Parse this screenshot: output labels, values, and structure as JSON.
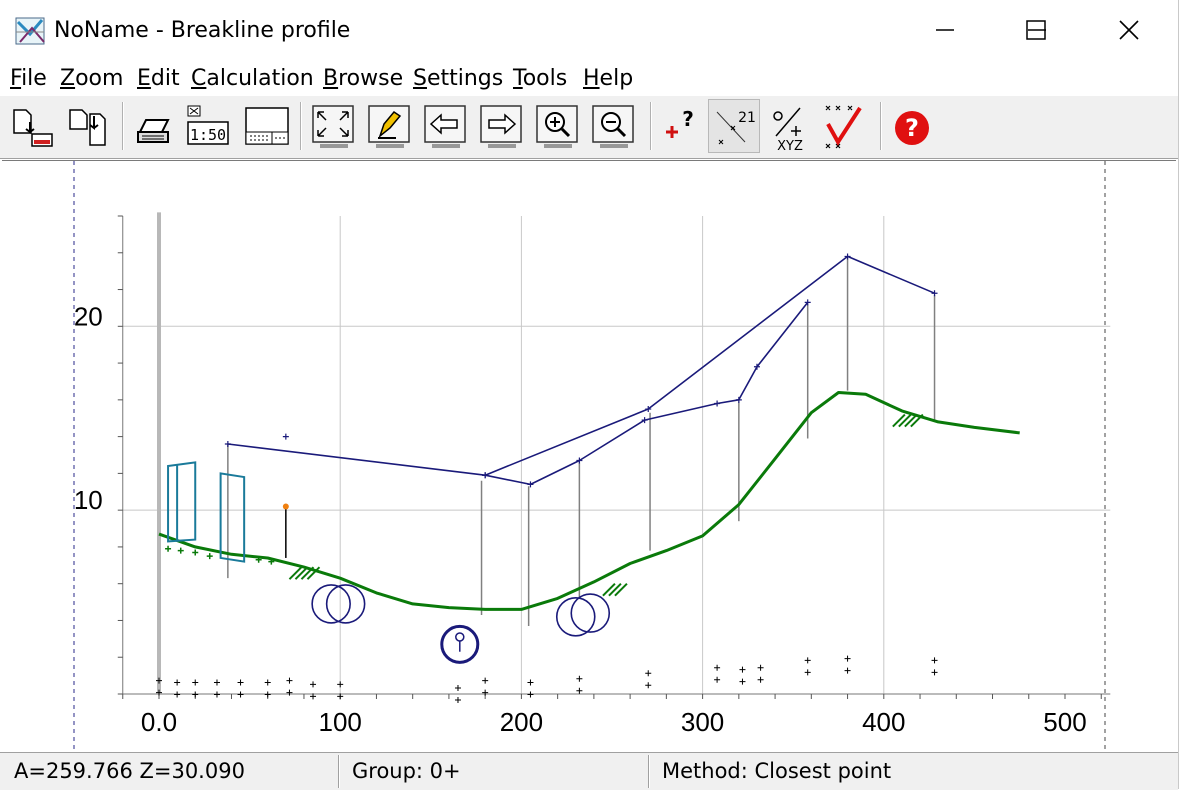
{
  "window": {
    "title": "NoName - Breakline profile",
    "controls": [
      "minimize",
      "maximize",
      "close"
    ]
  },
  "menu": [
    {
      "label": "File",
      "accel": "F",
      "rest": "ile"
    },
    {
      "label": "Zoom",
      "accel": "Z",
      "rest": "oom"
    },
    {
      "label": "Edit",
      "accel": "E",
      "rest": "dit"
    },
    {
      "label": "Calculation",
      "accel": "C",
      "rest": "alculation"
    },
    {
      "label": "Browse",
      "accel": "B",
      "rest": "rowse"
    },
    {
      "label": "Settings",
      "accel": "S",
      "rest": "ettings"
    },
    {
      "label": "Tools",
      "accel": "T",
      "rest": "ools"
    },
    {
      "label": "Help",
      "accel": "H",
      "rest": "elp"
    }
  ],
  "toolbar": {
    "scale_label": "1:50",
    "point_number_label": "21",
    "xyz_label": "XYZ",
    "icons": [
      "import-icon",
      "export-icon",
      "print-icon",
      "scale-icon",
      "layout-icon",
      "zoom-extents-icon",
      "edit-pencil-icon",
      "pan-left-icon",
      "pan-right-icon",
      "zoom-in-icon",
      "zoom-out-icon",
      "add-point-query-icon",
      "point-number-icon",
      "xyz-icon",
      "check-icon",
      "help-icon"
    ]
  },
  "chart_data": {
    "type": "line",
    "xlim": [
      -20,
      525
    ],
    "ylim": [
      0,
      26
    ],
    "x_ticks": [
      "0.0",
      "100",
      "200",
      "300",
      "400",
      "500"
    ],
    "y_ticks": [
      "10",
      "20"
    ],
    "grid": true,
    "series": [
      {
        "role": "terrain-green",
        "color": "#0a7a0a",
        "points": [
          [
            0,
            8.7
          ],
          [
            20,
            8.0
          ],
          [
            40,
            7.6
          ],
          [
            60,
            7.4
          ],
          [
            80,
            6.9
          ],
          [
            100,
            6.3
          ],
          [
            120,
            5.5
          ],
          [
            140,
            4.9
          ],
          [
            160,
            4.7
          ],
          [
            180,
            4.6
          ],
          [
            200,
            4.6
          ],
          [
            220,
            5.2
          ],
          [
            240,
            6.1
          ],
          [
            260,
            7.1
          ],
          [
            280,
            7.8
          ],
          [
            300,
            8.6
          ],
          [
            320,
            10.3
          ],
          [
            340,
            12.8
          ],
          [
            360,
            15.3
          ],
          [
            375,
            16.4
          ],
          [
            390,
            16.3
          ],
          [
            410,
            15.4
          ],
          [
            430,
            14.8
          ],
          [
            450,
            14.5
          ],
          [
            475,
            14.2
          ]
        ]
      },
      {
        "role": "profile-upper",
        "color": "#1a1a7a",
        "points": [
          [
            38,
            13.6
          ],
          [
            180,
            11.9
          ],
          [
            270,
            15.5
          ],
          [
            380,
            23.8
          ],
          [
            428,
            21.8
          ]
        ]
      },
      {
        "role": "profile-lower",
        "color": "#1a1a7a",
        "points": [
          [
            180,
            11.9
          ],
          [
            205,
            11.4
          ],
          [
            232,
            12.7
          ],
          [
            268,
            14.9
          ],
          [
            308,
            15.8
          ],
          [
            320,
            16.0
          ],
          [
            330,
            17.8
          ],
          [
            358,
            21.3
          ]
        ]
      }
    ],
    "vertical_lines": [
      [
        38,
        13.6,
        6.3
      ],
      [
        70,
        10.2,
        7.4
      ],
      [
        178,
        11.6,
        4.3
      ],
      [
        204,
        11.3,
        3.7
      ],
      [
        232,
        12.6,
        5.2
      ],
      [
        271,
        15.3,
        7.8
      ],
      [
        320,
        15.9,
        9.4
      ],
      [
        358,
        21.2,
        13.9
      ],
      [
        380,
        23.7,
        16.5
      ],
      [
        428,
        21.7,
        14.8
      ]
    ],
    "isolated_points": [
      [
        70,
        14.0
      ]
    ],
    "ground_marks": [
      [
        0,
        0.4
      ],
      [
        10,
        0.3
      ],
      [
        20,
        0.3
      ],
      [
        32,
        0.3
      ],
      [
        45,
        0.3
      ],
      [
        60,
        0.3
      ],
      [
        72,
        0.4
      ],
      [
        85,
        0.2
      ],
      [
        100,
        0.2
      ],
      [
        165,
        0.0
      ],
      [
        180,
        0.4
      ],
      [
        205,
        0.3
      ],
      [
        232,
        0.5
      ],
      [
        270,
        0.8
      ],
      [
        308,
        1.1
      ],
      [
        322,
        1.0
      ],
      [
        332,
        1.1
      ],
      [
        358,
        1.5
      ],
      [
        380,
        1.6
      ],
      [
        428,
        1.5
      ]
    ]
  },
  "statusbar": {
    "coords": "A=259.766  Z=30.090",
    "group": "Group: 0+",
    "method": "Method: Closest point"
  }
}
